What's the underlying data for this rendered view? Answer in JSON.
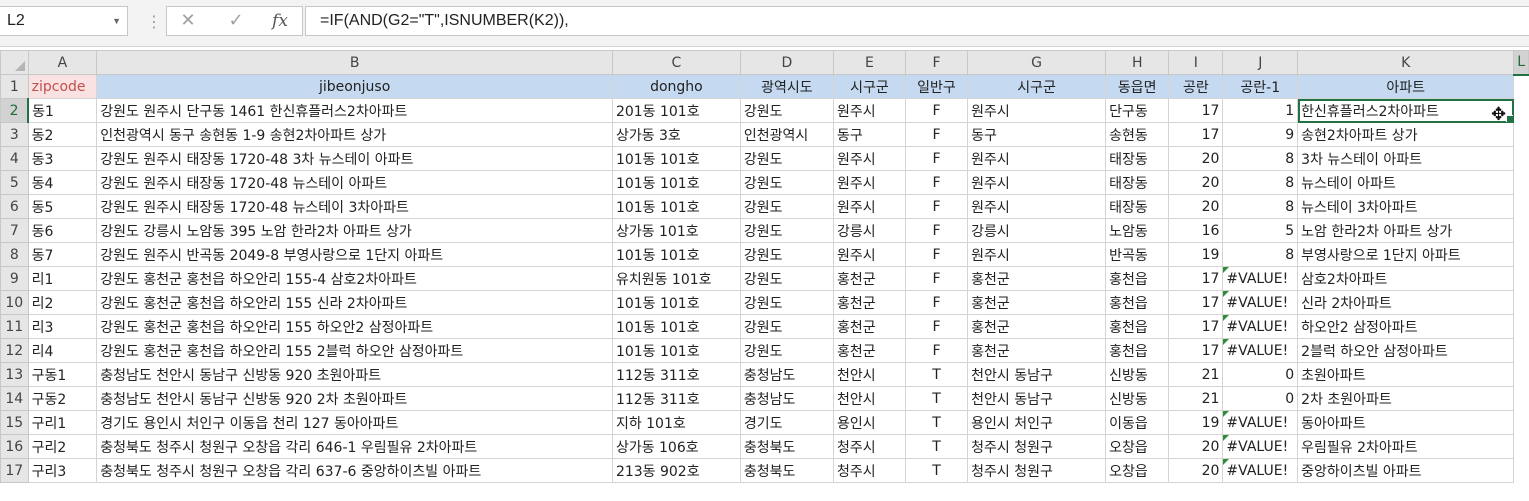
{
  "name_box": {
    "value": "L2"
  },
  "formula_bar": {
    "formula": "=IF(AND(G2=\"T\",ISNUMBER(K2)),",
    "cancel_icon": "close-icon",
    "enter_icon": "check-icon",
    "fx_label": "fx"
  },
  "columns": [
    "A",
    "B",
    "C",
    "D",
    "E",
    "F",
    "G",
    "H",
    "I",
    "J",
    "K",
    "L"
  ],
  "active_column": "L",
  "active_row": 2,
  "header_row": [
    "zipcode",
    "jibeonjuso",
    "dongho",
    "광역시도",
    "시구군",
    "일반구",
    "시구군",
    "동읍면",
    "공란",
    "공란-1",
    "아파트"
  ],
  "rows": [
    {
      "num": "2",
      "cells": [
        "동1",
        "강원도 원주시 단구동 1461 한신휴플러스2차아파트",
        "201동 101호",
        "강원도",
        "원주시",
        "F",
        "원주시",
        "단구동",
        "17",
        "1",
        "한신휴플러스2차아파트"
      ]
    },
    {
      "num": "3",
      "cells": [
        "동2",
        "인천광역시 동구 송현동 1-9 송현2차아파트 상가",
        "상가동 3호",
        "인천광역시",
        "동구",
        "F",
        "동구",
        "송현동",
        "17",
        "9",
        "송현2차아파트 상가"
      ]
    },
    {
      "num": "4",
      "cells": [
        "동3",
        "강원도 원주시 태장동 1720-48 3차 뉴스테이 아파트",
        "101동 101호",
        "강원도",
        "원주시",
        "F",
        "원주시",
        "태장동",
        "20",
        "8",
        "3차 뉴스테이 아파트"
      ]
    },
    {
      "num": "5",
      "cells": [
        "동4",
        "강원도 원주시 태장동 1720-48 뉴스테이 아파트",
        "101동 101호",
        "강원도",
        "원주시",
        "F",
        "원주시",
        "태장동",
        "20",
        "8",
        "뉴스테이 아파트"
      ]
    },
    {
      "num": "6",
      "cells": [
        "동5",
        "강원도 원주시 태장동 1720-48 뉴스테이 3차아파트",
        "101동 101호",
        "강원도",
        "원주시",
        "F",
        "원주시",
        "태장동",
        "20",
        "8",
        "뉴스테이 3차아파트"
      ]
    },
    {
      "num": "7",
      "cells": [
        "동6",
        "강원도 강릉시 노암동 395 노암 한라2차 아파트 상가",
        "상가동 101호",
        "강원도",
        "강릉시",
        "F",
        "강릉시",
        "노암동",
        "16",
        "5",
        "노암 한라2차 아파트 상가"
      ]
    },
    {
      "num": "8",
      "cells": [
        "동7",
        "강원도 원주시 반곡동 2049-8 부영사랑으로 1단지 아파트",
        "101동 101호",
        "강원도",
        "원주시",
        "F",
        "원주시",
        "반곡동",
        "19",
        "8",
        "부영사랑으로 1단지 아파트"
      ]
    },
    {
      "num": "9",
      "cells": [
        "리1",
        "강원도 홍천군 홍천읍 하오안리 155-4 삼호2차아파트",
        "유치원동 101호",
        "강원도",
        "홍천군",
        "F",
        "홍천군",
        "홍천읍",
        "17",
        "#VALUE!",
        "삼호2차아파트"
      ]
    },
    {
      "num": "10",
      "cells": [
        "리2",
        "강원도 홍천군 홍천읍 하오안리 155 신라 2차아파트",
        "101동 101호",
        "강원도",
        "홍천군",
        "F",
        "홍천군",
        "홍천읍",
        "17",
        "#VALUE!",
        "신라 2차아파트"
      ]
    },
    {
      "num": "11",
      "cells": [
        "리3",
        "강원도 홍천군 홍천읍 하오안리 155 하오안2 삼정아파트",
        "101동 101호",
        "강원도",
        "홍천군",
        "F",
        "홍천군",
        "홍천읍",
        "17",
        "#VALUE!",
        "하오안2 삼정아파트"
      ]
    },
    {
      "num": "12",
      "cells": [
        "리4",
        "강원도 홍천군 홍천읍 하오안리 155 2블럭 하오안 삼정아파트",
        "101동 101호",
        "강원도",
        "홍천군",
        "F",
        "홍천군",
        "홍천읍",
        "17",
        "#VALUE!",
        "2블럭 하오안 삼정아파트"
      ]
    },
    {
      "num": "13",
      "cells": [
        "구동1",
        "충청남도 천안시 동남구 신방동 920 초원아파트",
        "112동 311호",
        "충청남도",
        "천안시",
        "T",
        "천안시 동남구",
        "신방동",
        "21",
        "0",
        "초원아파트"
      ]
    },
    {
      "num": "14",
      "cells": [
        "구동2",
        "충청남도 천안시 동남구 신방동 920 2차 초원아파트",
        "112동 311호",
        "충청남도",
        "천안시",
        "T",
        "천안시 동남구",
        "신방동",
        "21",
        "0",
        "2차 초원아파트"
      ]
    },
    {
      "num": "15",
      "cells": [
        "구리1",
        "경기도 용인시 처인구 이동읍 천리 127 동아아파트",
        "지하 101호",
        "경기도",
        "용인시",
        "T",
        "용인시 처인구",
        "이동읍",
        "19",
        "#VALUE!",
        "동아아파트"
      ]
    },
    {
      "num": "16",
      "cells": [
        "구리2",
        "충청북도 청주시 청원구 오창읍 각리 646-1 우림필유 2차아파트",
        "상가동 106호",
        "충청북도",
        "청주시",
        "T",
        "청주시 청원구",
        "오창읍",
        "20",
        "#VALUE!",
        "우림필유 2차아파트"
      ]
    },
    {
      "num": "17",
      "cells": [
        "구리3",
        "충청북도 청주시 청원구 오창읍 각리 637-6 중앙하이츠빌 아파트",
        "213동 902호",
        "충청북도",
        "청주시",
        "T",
        "청주시 청원구",
        "오창읍",
        "20",
        "#VALUE!",
        "중앙하이츠빌 아파트"
      ]
    }
  ],
  "colors": {
    "header_fill": "#c5d9f1",
    "zipcode_fill": "#fbe2e2",
    "selection": "#217346",
    "error_flag": "#2e8b3a"
  },
  "cursor_icon": "plus-cross-cursor-icon"
}
